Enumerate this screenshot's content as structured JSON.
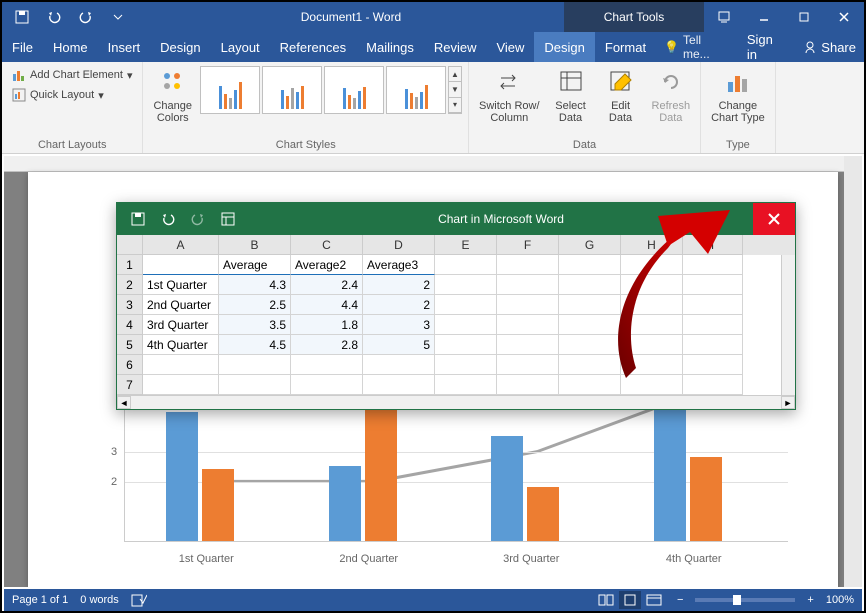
{
  "titlebar": {
    "doc_title": "Document1 - Word",
    "chart_tools": "Chart Tools"
  },
  "menu": {
    "file": "File",
    "home": "Home",
    "insert": "Insert",
    "design_doc": "Design",
    "layout": "Layout",
    "references": "References",
    "mailings": "Mailings",
    "review": "Review",
    "view": "View",
    "design": "Design",
    "format": "Format",
    "tell_me": "Tell me...",
    "sign_in": "Sign in",
    "share": "Share"
  },
  "ribbon": {
    "chart_layouts": {
      "add_element": "Add Chart Element",
      "quick_layout": "Quick Layout",
      "group": "Chart Layouts"
    },
    "change_colors": "Change\nColors",
    "chart_styles_group": "Chart Styles",
    "data": {
      "switch": "Switch Row/\nColumn",
      "select": "Select\nData",
      "edit": "Edit\nData",
      "refresh": "Refresh\nData",
      "group": "Data"
    },
    "type": {
      "change": "Change\nChart Type",
      "group": "Type"
    }
  },
  "excel": {
    "title": "Chart in Microsoft Word",
    "cols": [
      "A",
      "B",
      "C",
      "D",
      "E",
      "F",
      "G",
      "H",
      "I"
    ],
    "header_row": [
      "",
      "Average",
      "Average2",
      "Average3"
    ],
    "rows": [
      [
        "1st Quarter",
        4.3,
        2.4,
        2
      ],
      [
        "2nd Quarter",
        2.5,
        4.4,
        2
      ],
      [
        "3rd Quarter",
        3.5,
        1.8,
        3
      ],
      [
        "4th Quarter",
        4.5,
        2.8,
        5
      ]
    ]
  },
  "chart_data": {
    "type": "bar",
    "categories": [
      "1st Quarter",
      "2nd Quarter",
      "3rd Quarter",
      "4th Quarter"
    ],
    "series": [
      {
        "name": "Average",
        "values": [
          4.3,
          2.5,
          3.5,
          4.5
        ],
        "color": "#5b9bd5"
      },
      {
        "name": "Average2",
        "values": [
          2.4,
          4.4,
          1.8,
          2.8
        ],
        "color": "#ed7d31"
      },
      {
        "name": "Average3",
        "values": [
          2,
          2,
          3,
          5
        ],
        "type": "line",
        "color": "#a5a5a5"
      }
    ],
    "ylim": [
      0,
      5
    ],
    "visible_y_ticks": [
      2,
      3
    ],
    "title": "",
    "xlabel": "",
    "ylabel": ""
  },
  "status": {
    "page": "Page 1 of 1",
    "words": "0 words",
    "zoom": "100%"
  }
}
